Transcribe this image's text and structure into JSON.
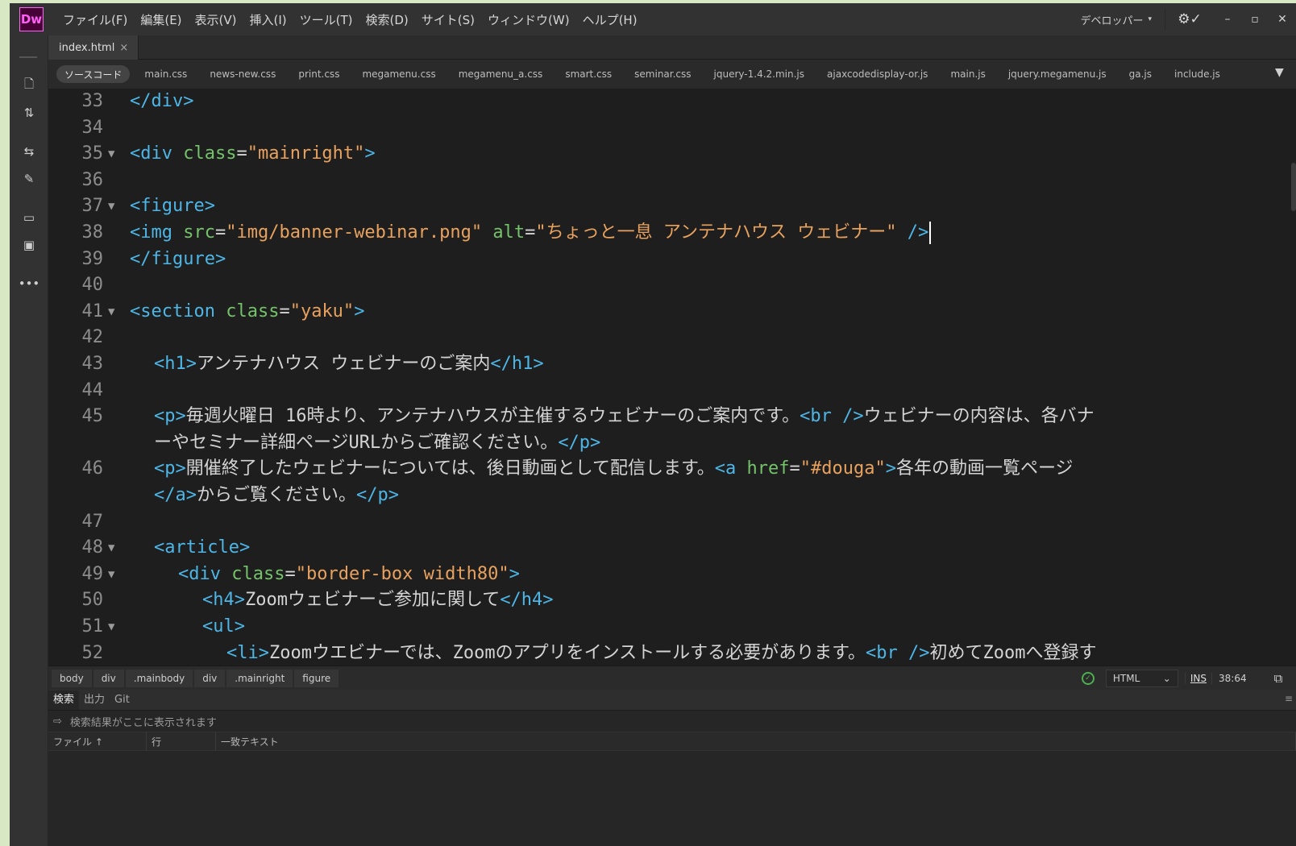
{
  "app": {
    "logo": "Dw"
  },
  "menu": [
    "ファイル(F)",
    "編集(E)",
    "表示(V)",
    "挿入(I)",
    "ツール(T)",
    "検索(D)",
    "サイト(S)",
    "ウィンドウ(W)",
    "ヘルプ(H)"
  ],
  "workspace": {
    "label": "デベロッパー",
    "caret": "▾"
  },
  "window_buttons": {
    "minimize": "–",
    "maximize": "▫",
    "close": "✕"
  },
  "document_tab": {
    "name": "index.html",
    "close": "×"
  },
  "related_files": {
    "source": "ソースコード",
    "files": [
      "main.css",
      "news-new.css",
      "print.css",
      "megamenu.css",
      "megamenu_a.css",
      "smart.css",
      "seminar.css",
      "jquery-1.4.2.min.js",
      "ajaxcodedisplay-or.js",
      "main.js",
      "jquery.megamenu.js",
      "ga.js",
      "include.js"
    ]
  },
  "code_lines": [
    {
      "n": "33",
      "fold": "",
      "indent": 0,
      "parts": [
        [
          "tg",
          "</div>"
        ]
      ]
    },
    {
      "n": "34",
      "fold": "",
      "indent": 0,
      "parts": []
    },
    {
      "n": "35",
      "fold": "▼",
      "indent": 0,
      "parts": [
        [
          "tg",
          "<div "
        ],
        [
          "at",
          "class"
        ],
        [
          "tx",
          "="
        ],
        [
          "st",
          "\"mainright\""
        ],
        [
          "tg",
          ">"
        ]
      ]
    },
    {
      "n": "36",
      "fold": "",
      "indent": 0,
      "parts": []
    },
    {
      "n": "37",
      "fold": "▼",
      "indent": 0,
      "parts": [
        [
          "tg",
          "<figure>"
        ]
      ]
    },
    {
      "n": "38",
      "fold": "",
      "indent": 0,
      "caret": true,
      "parts": [
        [
          "tg",
          "<img "
        ],
        [
          "at",
          "src"
        ],
        [
          "tx",
          "="
        ],
        [
          "st",
          "\"img/banner-webinar.png\""
        ],
        [
          "tx",
          " "
        ],
        [
          "at",
          "alt"
        ],
        [
          "tx",
          "="
        ],
        [
          "st",
          "\"ちょっと一息 アンテナハウス ウェビナー\""
        ],
        [
          "tx",
          " "
        ],
        [
          "tg",
          "/>"
        ]
      ]
    },
    {
      "n": "39",
      "fold": "",
      "indent": 0,
      "parts": [
        [
          "tg",
          "</figure>"
        ]
      ]
    },
    {
      "n": "40",
      "fold": "",
      "indent": 0,
      "parts": []
    },
    {
      "n": "41",
      "fold": "▼",
      "indent": 0,
      "parts": [
        [
          "tg",
          "<section "
        ],
        [
          "at",
          "class"
        ],
        [
          "tx",
          "="
        ],
        [
          "st",
          "\"yaku\""
        ],
        [
          "tg",
          ">"
        ]
      ]
    },
    {
      "n": "42",
      "fold": "",
      "indent": 0,
      "parts": []
    },
    {
      "n": "43",
      "fold": "",
      "indent": 1,
      "parts": [
        [
          "tg",
          "<h1>"
        ],
        [
          "tx",
          "アンテナハウス ウェビナーのご案内"
        ],
        [
          "tg",
          "</h1>"
        ]
      ]
    },
    {
      "n": "44",
      "fold": "",
      "indent": 0,
      "parts": []
    },
    {
      "n": "45",
      "fold": "",
      "indent": 1,
      "parts": [
        [
          "tg",
          "<p>"
        ],
        [
          "tx",
          "毎週火曜日 16時より、アンテナハウスが主催するウェビナーのご案内です。"
        ],
        [
          "tg",
          "<br />"
        ],
        [
          "tx",
          "ウェビナーの内容は、各バナ"
        ]
      ]
    },
    {
      "n": "",
      "fold": "",
      "indent": 1,
      "parts": [
        [
          "tx",
          "ーやセミナー詳細ページURLからご確認ください。"
        ],
        [
          "tg",
          "</p>"
        ]
      ]
    },
    {
      "n": "46",
      "fold": "",
      "indent": 1,
      "parts": [
        [
          "tg",
          "<p>"
        ],
        [
          "tx",
          "開催終了したウェビナーについては、後日動画として配信します。"
        ],
        [
          "tg",
          "<a "
        ],
        [
          "at",
          "href"
        ],
        [
          "tx",
          "="
        ],
        [
          "st",
          "\"#douga\""
        ],
        [
          "tg",
          ">"
        ],
        [
          "tx",
          "各年の動画一覧ページ"
        ]
      ]
    },
    {
      "n": "",
      "fold": "",
      "indent": 1,
      "parts": [
        [
          "tg",
          "</a>"
        ],
        [
          "tx",
          "からご覧ください。"
        ],
        [
          "tg",
          "</p>"
        ]
      ]
    },
    {
      "n": "47",
      "fold": "",
      "indent": 0,
      "parts": []
    },
    {
      "n": "48",
      "fold": "▼",
      "indent": 1,
      "parts": [
        [
          "tg",
          "<article>"
        ]
      ]
    },
    {
      "n": "49",
      "fold": "▼",
      "indent": 2,
      "parts": [
        [
          "tg",
          "<div "
        ],
        [
          "at",
          "class"
        ],
        [
          "tx",
          "="
        ],
        [
          "st",
          "\"border-box width80\""
        ],
        [
          "tg",
          ">"
        ]
      ]
    },
    {
      "n": "50",
      "fold": "",
      "indent": 3,
      "parts": [
        [
          "tg",
          "<h4>"
        ],
        [
          "tx",
          "Zoomウェビナーご参加に関して"
        ],
        [
          "tg",
          "</h4>"
        ]
      ]
    },
    {
      "n": "51",
      "fold": "▼",
      "indent": 3,
      "parts": [
        [
          "tg",
          "<ul>"
        ]
      ]
    },
    {
      "n": "52",
      "fold": "",
      "indent": 4,
      "parts": [
        [
          "tg",
          "<li>"
        ],
        [
          "tx",
          "Zoomウエビナーでは、Zoomのアプリをインストールする必要があります。"
        ],
        [
          "tg",
          "<br />"
        ],
        [
          "tx",
          "初めてZoomへ登録す"
        ]
      ]
    }
  ],
  "breadcrumbs": [
    "body",
    "div",
    ".mainbody",
    "div",
    ".mainright",
    "figure"
  ],
  "status": {
    "language": "HTML",
    "mode": "INS",
    "cursor": "38:64"
  },
  "bottom_panel": {
    "tabs": [
      "検索",
      "出力",
      "Git"
    ],
    "message": "検索結果がここに表示されます",
    "columns": [
      "ファイル ↑",
      "行",
      "一致テキスト"
    ]
  }
}
